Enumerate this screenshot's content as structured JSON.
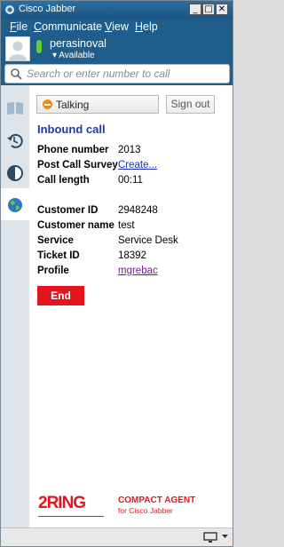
{
  "window": {
    "title": "Cisco Jabber"
  },
  "menu": {
    "items": [
      {
        "first": "F",
        "rest": "ile"
      },
      {
        "first": "C",
        "rest": "ommunicate"
      },
      {
        "first": "V",
        "rest": "iew"
      },
      {
        "first": "H",
        "rest": "elp"
      }
    ]
  },
  "profile": {
    "username": "perasinoval",
    "status": "▾ Available",
    "status_color": "#5fd12a"
  },
  "search": {
    "placeholder": "Search or enter number to call"
  },
  "sidebar": {
    "items": [
      {
        "icon": "contacts-book-icon"
      },
      {
        "icon": "recent-calls-icon"
      },
      {
        "icon": "contrast-icon"
      },
      {
        "icon": "globe-icon",
        "active": true
      }
    ]
  },
  "agent": {
    "state": "Talking",
    "state_color": "#f08a17",
    "signout_label": "Sign out"
  },
  "call": {
    "heading": "Inbound call",
    "phone_label": "Phone number",
    "phone_value": "2013",
    "survey_label": "Post Call Survey",
    "survey_link": "Create...",
    "length_label": "Call length",
    "length_value": "00:11",
    "customer_id_label": "Customer ID",
    "customer_id_value": "2948248",
    "customer_name_label": "Customer name",
    "customer_name_value": "test",
    "service_label": "Service",
    "service_value": "Service Desk",
    "ticket_label": "Ticket ID",
    "ticket_value": "18392",
    "profile_label": "Profile",
    "profile_link": "mgrebac",
    "end_label": "End",
    "end_color": "#e3161f"
  },
  "branding": {
    "logo": "2RING",
    "line1": "COMPACT AGENT",
    "line2": "for Cisco Jabber",
    "color": "#e3161f"
  }
}
